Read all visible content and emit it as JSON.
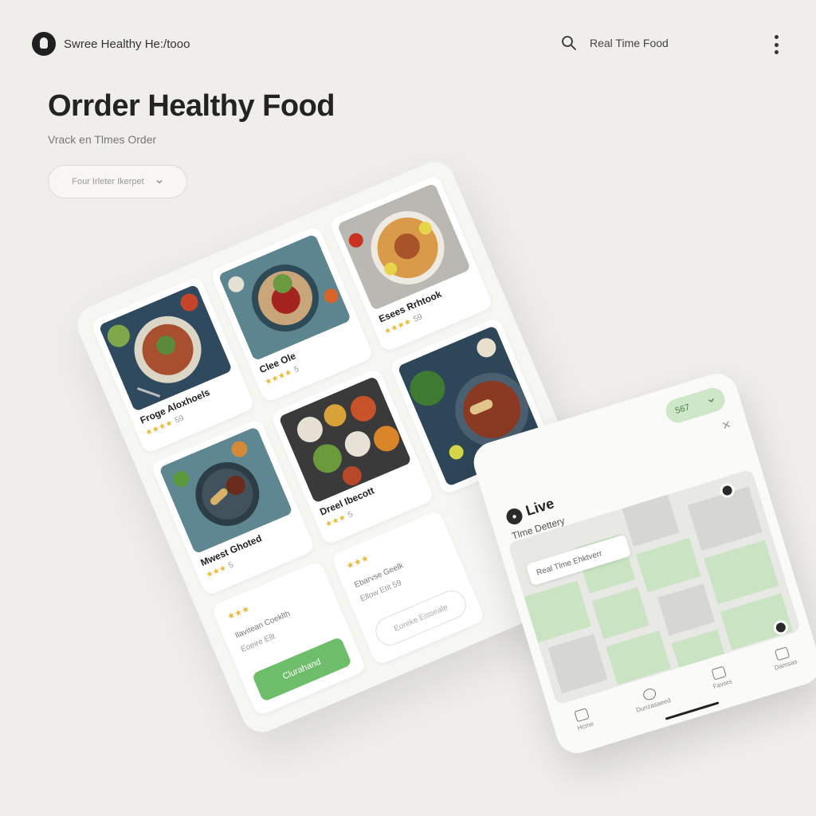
{
  "header": {
    "brand": "Swree Healthy He:/tooo",
    "search_label": "Real Time Food",
    "icons": {
      "logo": "avatar-logo-icon",
      "search": "search-icon",
      "menu": "kebab-menu-icon"
    }
  },
  "hero": {
    "title": "Orrder Healthy Food",
    "subtitle": "Vrack en Tlmes Order",
    "filter_label": "Four Irleter Ikerpet"
  },
  "menu": {
    "cards": [
      {
        "title": "Froge Aloxhoels",
        "stars": "★★★★",
        "count": "59"
      },
      {
        "title": "Clee Ole",
        "stars": "★★★★",
        "count": "5"
      },
      {
        "title": "Esees Rrhtook",
        "stars": "★★★★",
        "count": "59"
      },
      {
        "title": "Mwest Ghoted",
        "stars": "★★★",
        "count": "5"
      },
      {
        "title": "Dreel Ibecott",
        "stars": "★★★",
        "count": "5"
      },
      {
        "title": "",
        "stars": "",
        "count": ""
      }
    ],
    "info_left": {
      "stars": "★★★",
      "line1": "Ilavitean Coeklth",
      "line2": "Eoeire Ellt",
      "button": "Clurahand"
    },
    "info_mid": {
      "stars": "★★★",
      "line1": "Ebarvse Geelk",
      "line2": "Ellow Etit 59",
      "button": "Eoreke Eisseale"
    }
  },
  "tracking": {
    "pill": "567",
    "title": "Live",
    "subtitle": "Tlme Dettery",
    "map_tag": "Real Tlme Ehktverr",
    "tabs": [
      {
        "label": "Hcme"
      },
      {
        "label": "Dunzasaeed"
      },
      {
        "label": "Favors"
      },
      {
        "label": "Damsas"
      }
    ]
  },
  "colors": {
    "accent_green": "#6dbd6a",
    "star": "#e8b93c",
    "background": "#efeeea"
  }
}
